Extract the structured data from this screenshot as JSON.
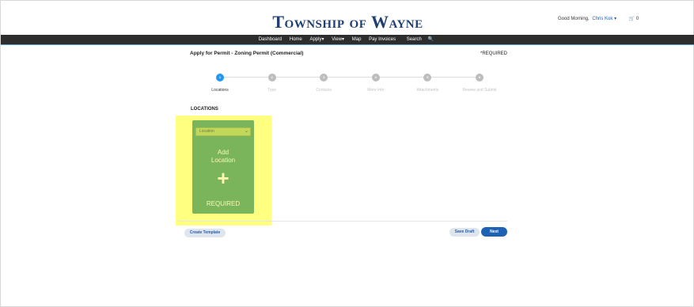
{
  "header": {
    "brand": "Township of Wayne",
    "greeting": "Good Morning,",
    "user_name": "Chris Kok",
    "user_caret": "▾",
    "cart_icon": "cart-icon",
    "cart_count": "0"
  },
  "nav": {
    "items": [
      "Dashboard",
      "Home",
      "Apply▾",
      "View▾",
      "Map",
      "Pay Invoices",
      "Search"
    ],
    "search_icon": "search-icon"
  },
  "page": {
    "title": "Apply for Permit - Zoning Permit (Commercial)",
    "required_note": "*REQUIRED"
  },
  "steps": [
    {
      "number": "1",
      "label": "Locations",
      "active": true
    },
    {
      "number": "2",
      "label": "Type",
      "active": false
    },
    {
      "number": "3",
      "label": "Contacts",
      "active": false
    },
    {
      "number": "4",
      "label": "More Info",
      "active": false
    },
    {
      "number": "5",
      "label": "Attachments",
      "active": false
    },
    {
      "number": "6",
      "label": "Review and Submit",
      "active": false
    }
  ],
  "locations": {
    "heading": "LOCATIONS",
    "select_placeholder": "Location",
    "add_label_line1": "Add",
    "add_label_line2": "Location",
    "plus": "+",
    "required_label": "REQUIRED"
  },
  "actions": {
    "create_template": "Create Template",
    "save_draft": "Save Draft",
    "next": "Next"
  },
  "colors": {
    "brand": "#1f3f73",
    "navbar": "#2d2d2d",
    "active_step": "#2196f3",
    "card": "#7ab55c",
    "highlight": "#ffff80",
    "primary_button": "#1f62b3"
  }
}
